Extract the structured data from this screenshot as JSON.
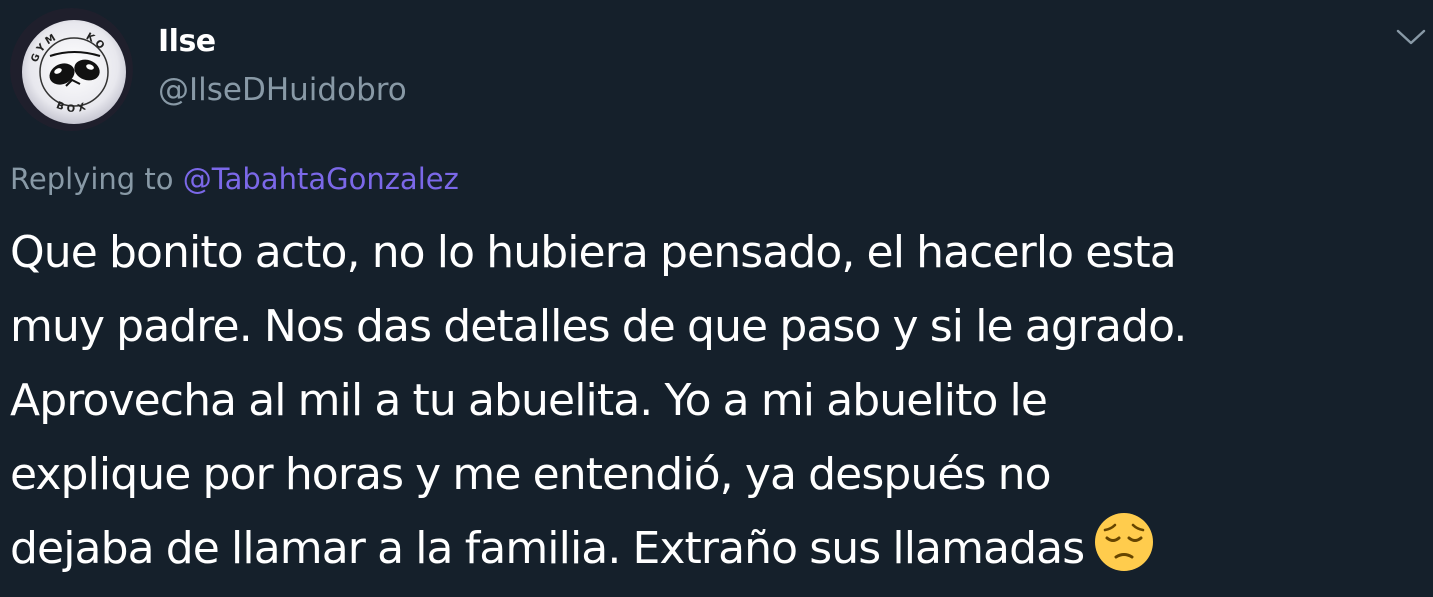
{
  "author": {
    "display_name": "Ilse",
    "handle": "@IlseDHuidobro",
    "avatar_icon": "gym-ko-box-logo",
    "avatar_text": [
      "GYM",
      "KO",
      "BOX"
    ]
  },
  "menu_icon": "chevron-down-icon",
  "reply": {
    "prefix": "Replying to ",
    "to_handle": "@TabahtaGonzalez"
  },
  "tweet": {
    "lines": [
      "Que bonito acto, no lo hubiera pensado, el hacerlo esta",
      "muy padre. Nos das detalles de que paso y si le agrado.",
      "Aprovecha al mil a tu abuelita. Yo a mi abuelito le",
      "explique por horas y me entendió, ya después no",
      "dejaba de llamar a la familia. Extraño sus llamadas"
    ],
    "emoji": "pensive-face-emoji"
  },
  "colors": {
    "background": "#15202b",
    "text_primary": "#ffffff",
    "text_secondary": "#8899a6",
    "link": "#7b68e8",
    "emoji_yellow": "#ffcc4d"
  }
}
